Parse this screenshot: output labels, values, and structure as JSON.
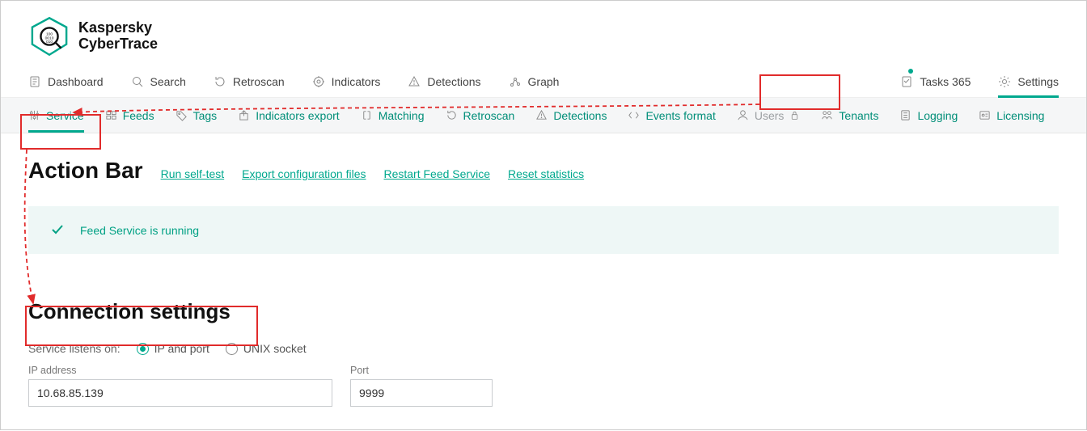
{
  "brand": {
    "line1": "Kaspersky",
    "line2": "CyberTrace"
  },
  "primaryNav": {
    "dashboard": "Dashboard",
    "search": "Search",
    "retroscan": "Retroscan",
    "indicators": "Indicators",
    "detections": "Detections",
    "graph": "Graph",
    "tasks": "Tasks 365",
    "settings": "Settings"
  },
  "subNav": {
    "service": "Service",
    "feeds": "Feeds",
    "tags": "Tags",
    "indicatorsExport": "Indicators export",
    "matching": "Matching",
    "retroscan": "Retroscan",
    "detections": "Detections",
    "eventsFormat": "Events format",
    "users": "Users",
    "tenants": "Tenants",
    "logging": "Logging",
    "licensing": "Licensing"
  },
  "actionBar": {
    "title": "Action Bar",
    "runSelfTest": "Run self-test",
    "exportConfig": "Export configuration files",
    "restartFeed": "Restart Feed Service",
    "resetStats": "Reset statistics"
  },
  "status": {
    "message": "Feed Service is running"
  },
  "connection": {
    "title": "Connection settings",
    "listensOnLabel": "Service listens on:",
    "ipAndPort": "IP and port",
    "unixSocket": "UNIX socket",
    "ipLabel": "IP address",
    "ipValue": "10.68.85.139",
    "portLabel": "Port",
    "portValue": "9999"
  }
}
